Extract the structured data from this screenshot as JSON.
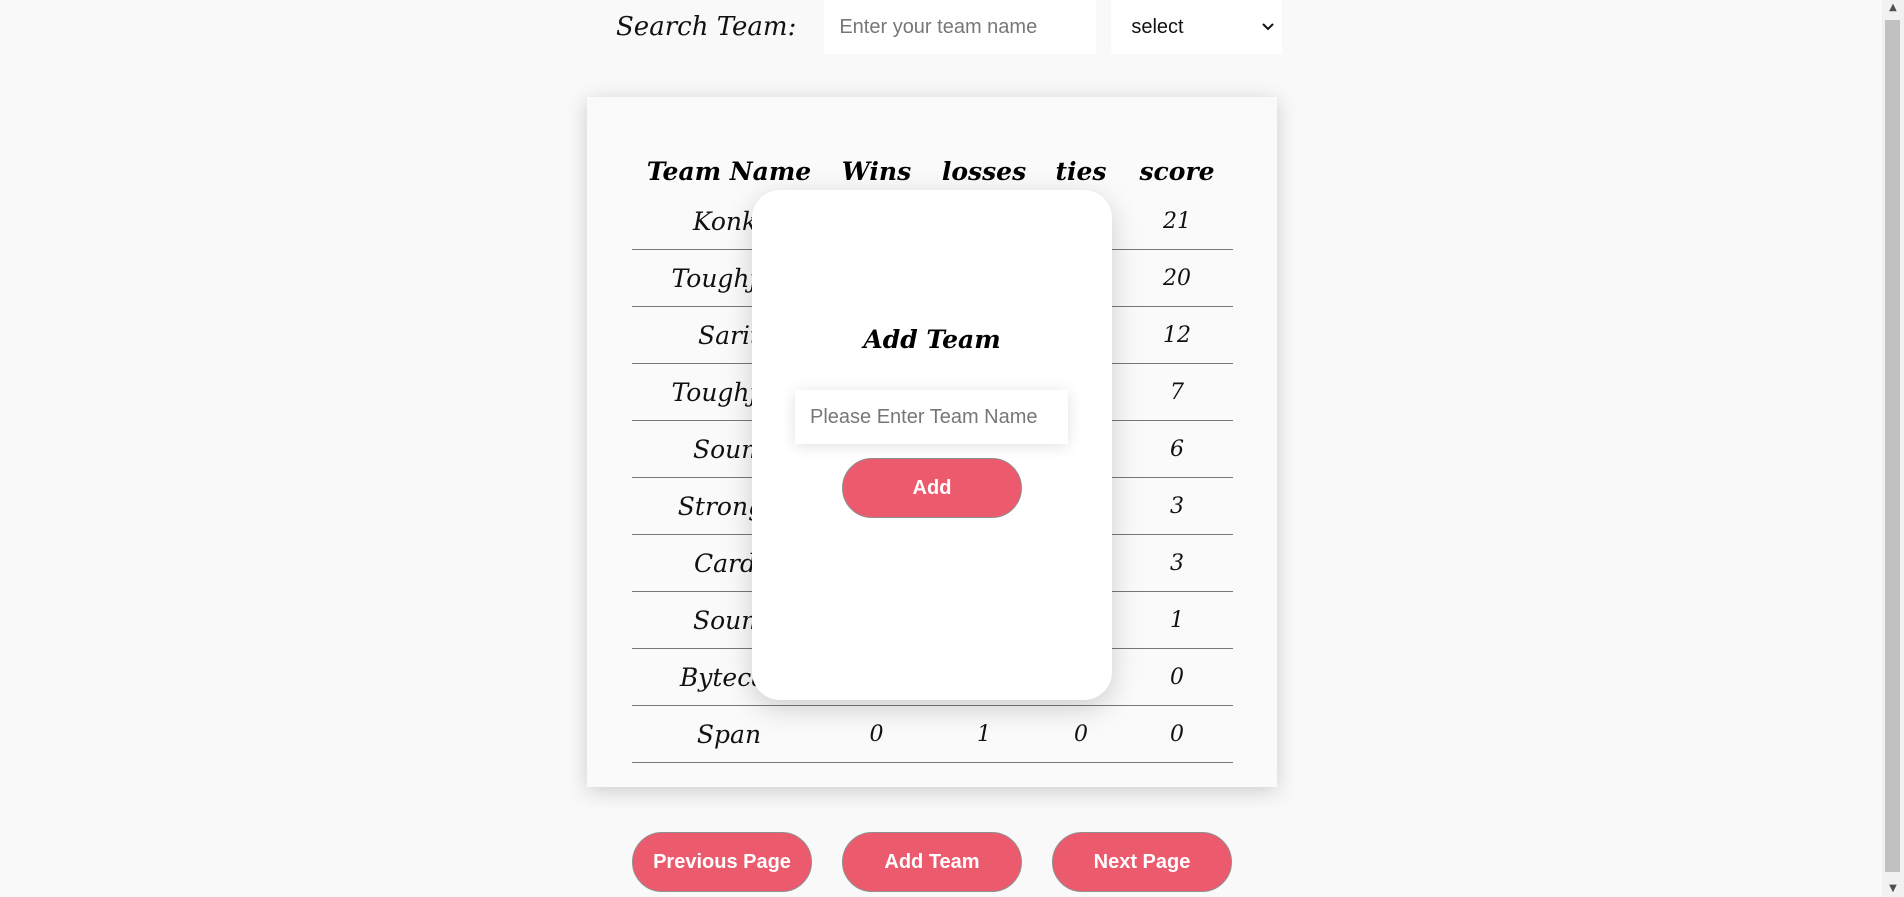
{
  "search": {
    "label": "Search Team:",
    "placeholder": "Enter your team name",
    "select_value": "select"
  },
  "table": {
    "headers": [
      "Team Name",
      "Wins",
      "losses",
      "ties",
      "score"
    ],
    "rows": [
      {
        "name": "Konkl",
        "wins": "",
        "losses": "",
        "ties": "",
        "score": "21"
      },
      {
        "name": "Toughjoy",
        "wins": "",
        "losses": "",
        "ties": "",
        "score": "20"
      },
      {
        "name": "Sarit",
        "wins": "",
        "losses": "",
        "ties": "",
        "score": "12"
      },
      {
        "name": "Toughjoy",
        "wins": "",
        "losses": "",
        "ties": "",
        "score": "7"
      },
      {
        "name": "Soum",
        "wins": "",
        "losses": "",
        "ties": "",
        "score": "6"
      },
      {
        "name": "Strongh",
        "wins": "",
        "losses": "",
        "ties": "",
        "score": "3"
      },
      {
        "name": "Cardi",
        "wins": "",
        "losses": "",
        "ties": "",
        "score": "3"
      },
      {
        "name": "Soum",
        "wins": "",
        "losses": "",
        "ties": "",
        "score": "1"
      },
      {
        "name": "Bytecar",
        "wins": "",
        "losses": "",
        "ties": "",
        "score": "0"
      },
      {
        "name": "Span",
        "wins": "0",
        "losses": "1",
        "ties": "0",
        "score": "0"
      }
    ]
  },
  "modal": {
    "title": "Add Team",
    "input_placeholder": "Please Enter Team Name",
    "add_label": "Add"
  },
  "pagination": {
    "prev_label": "Previous Page",
    "add_team_label": "Add Team",
    "next_label": "Next Page"
  },
  "colors": {
    "accent": "#ec5a6d",
    "background": "#f9f9f9"
  }
}
